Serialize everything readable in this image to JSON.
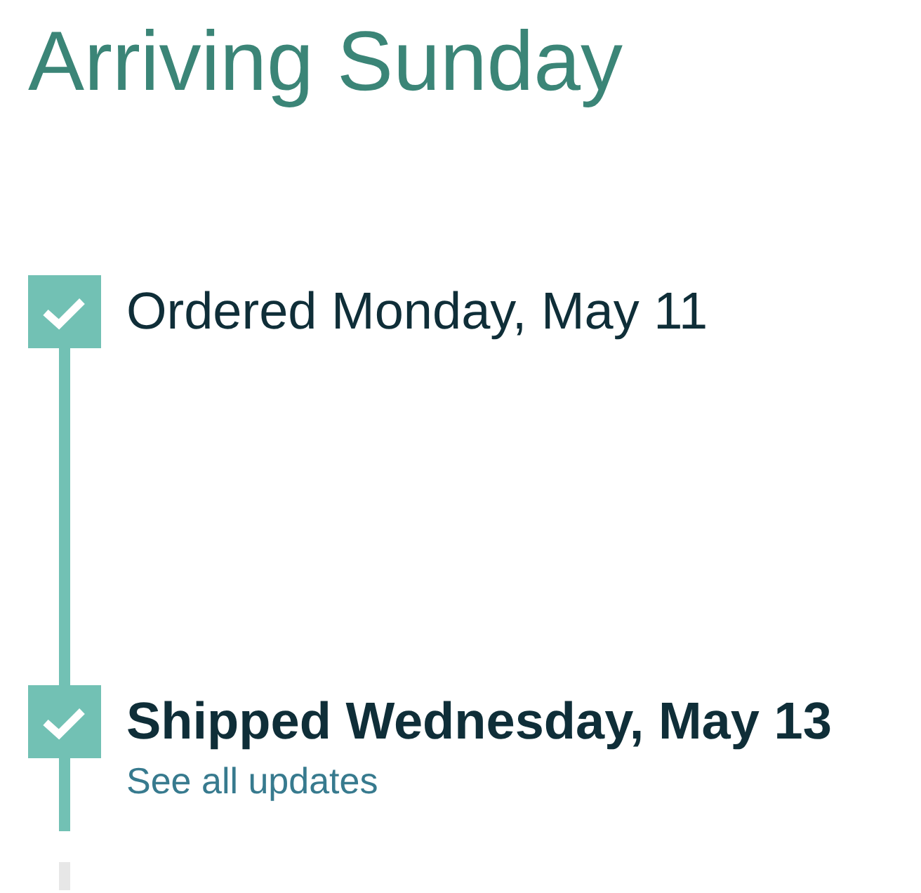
{
  "heading": "Arriving Sunday",
  "steps": [
    {
      "label": "Ordered Monday, May 11",
      "completed": true,
      "current": false
    },
    {
      "label": "Shipped Wednesday, May 13",
      "completed": true,
      "current": true,
      "link": "See all updates"
    }
  ],
  "more_steps": true
}
